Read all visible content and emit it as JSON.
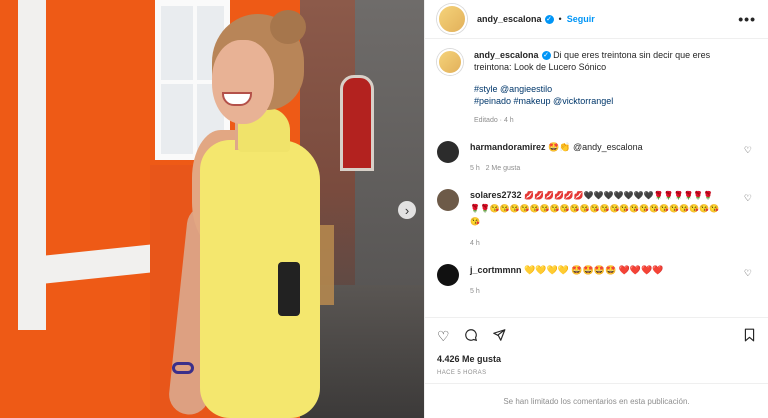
{
  "post": {
    "username": "andy_escalona",
    "follow_label": "Seguir",
    "more_label": "•••",
    "caption_text": "Di que eres treintona sin decir que eres treintona: Look de Lucero Sónico",
    "caption_line2": "#style @angieestilo",
    "caption_line3": "#peinado #makeup @vicktorrangel",
    "edited_label": "Editado · 4 h"
  },
  "comments": [
    {
      "username": "harmandoramirez",
      "text": "🤩👏 @andy_escalona",
      "time": "5 h",
      "likes": "2 Me gusta"
    },
    {
      "username": "solares2732",
      "text": "💋💋💋💋💋💋🖤🖤🖤🖤🖤🖤🖤🌹🌹🌹🌹🌹🌹🌹🌹😘😘😘😘😘😘😘😘😘😘😘😘😘😘😘😘😘😘😘😘😘😘😘😘",
      "time": "4 h",
      "likes": ""
    },
    {
      "username": "j_cortmmnn",
      "text": "💛💛💛💛 🤩🤩🤩🤩 ❤️❤️❤️❤️",
      "time": "5 h",
      "likes": ""
    }
  ],
  "stats": {
    "likes_label": "4.426 Me gusta",
    "ago_label": "HACE 5 HORAS"
  },
  "footer": {
    "limited_text": "Se han limitado los comentarios en esta publicación."
  },
  "icons": {
    "heart": "heart-icon",
    "comment": "comment-icon",
    "share": "share-icon",
    "bookmark": "bookmark-icon",
    "next": "chevron-right-icon"
  },
  "colors": {
    "accent": "#0095f6",
    "dress": "#f4e76e",
    "wall": "#ee5a16"
  }
}
